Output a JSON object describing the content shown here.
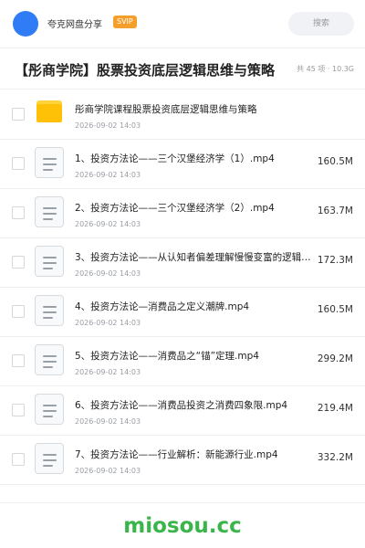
{
  "header": {
    "brand": "夸克网盘分享",
    "badge": "SVIP",
    "search_placeholder": "搜索"
  },
  "share": {
    "title": "【彤商学院】股票投资底层逻辑思维与策略",
    "meta": "共 45 项 · 10.3G"
  },
  "files": [
    {
      "type": "folder",
      "icon": "folder-icon",
      "name": "彤商学院课程股票投资底层逻辑思维与策略",
      "date": "2026-09-02 14:03",
      "size": ""
    },
    {
      "type": "file",
      "icon": "document-icon",
      "name": "1、投资方法论——三个汉堡经济学（1）.mp4",
      "date": "2026-09-02 14:03",
      "size": "160.5M"
    },
    {
      "type": "file",
      "icon": "document-icon",
      "name": "2、投资方法论——三个汉堡经济学（2）.mp4",
      "date": "2026-09-02 14:03",
      "size": "163.7M"
    },
    {
      "type": "file",
      "icon": "document-icon",
      "name": "3、投资方法论——从认知者偏差理解慢慢变富的逻辑…",
      "date": "2026-09-02 14:03",
      "size": "172.3M"
    },
    {
      "type": "file",
      "icon": "document-icon",
      "name": "4、投资方法论—消费品之定义潮牌.mp4",
      "date": "2026-09-02 14:03",
      "size": "160.5M"
    },
    {
      "type": "file",
      "icon": "document-icon",
      "name": "5、投资方法论——消费品之“锚”定理.mp4",
      "date": "2026-09-02 14:03",
      "size": "299.2M"
    },
    {
      "type": "file",
      "icon": "document-icon",
      "name": "6、投资方法论——消费品投资之消费四象限.mp4",
      "date": "2026-09-02 14:03",
      "size": "219.4M"
    },
    {
      "type": "file",
      "icon": "document-icon",
      "name": "7、投资方法论——行业解析：新能源行业.mp4",
      "date": "2026-09-02 14:03",
      "size": "332.2M"
    }
  ],
  "watermark": "miosou.cc"
}
